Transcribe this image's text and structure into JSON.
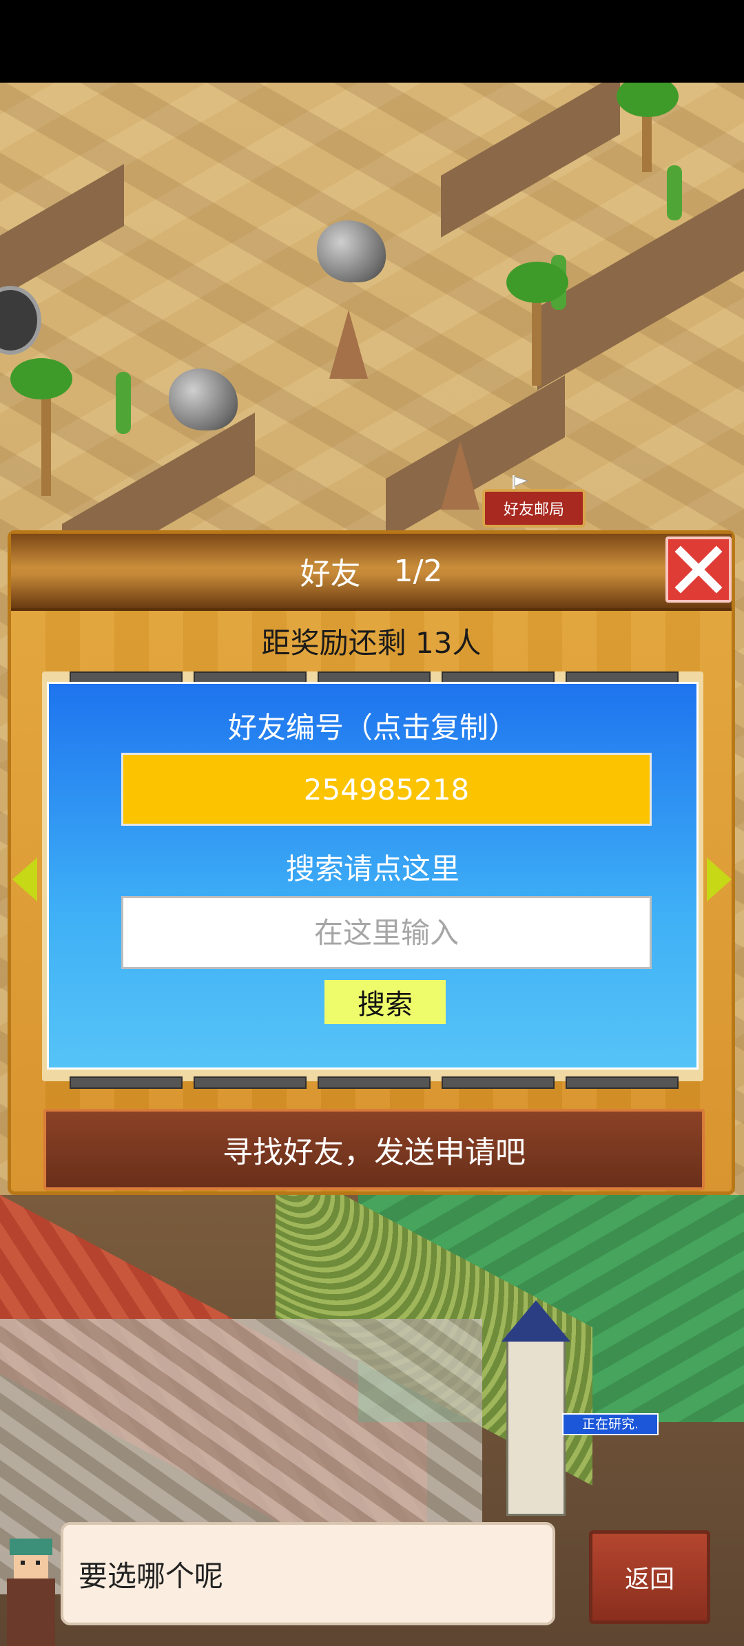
{
  "map": {
    "mailbox_label": "好友邮局",
    "research_badge": "正在研究."
  },
  "panel": {
    "title": "好友",
    "page": "1/2",
    "reward_text": "距奖励还剩 13人",
    "friend_id_label": "好友编号（点击复制）",
    "friend_id_value": "254985218",
    "search_label": "搜索请点这里",
    "search_placeholder": "在这里输入",
    "search_button": "搜索",
    "find_friends_banner": "寻找好友，发送申请吧"
  },
  "dialog": {
    "text": "要选哪个呢",
    "back_button": "返回"
  },
  "icons": {
    "close": "close-icon",
    "prev": "arrow-left-icon",
    "next": "arrow-right-icon",
    "mailbox_flag": "flag-icon"
  },
  "colors": {
    "panel_bg": "#d9952a",
    "close_red": "#e03c36",
    "id_box": "#fbc300",
    "search_button": "#eefb6a",
    "banner_brown": "#7a3a22"
  }
}
